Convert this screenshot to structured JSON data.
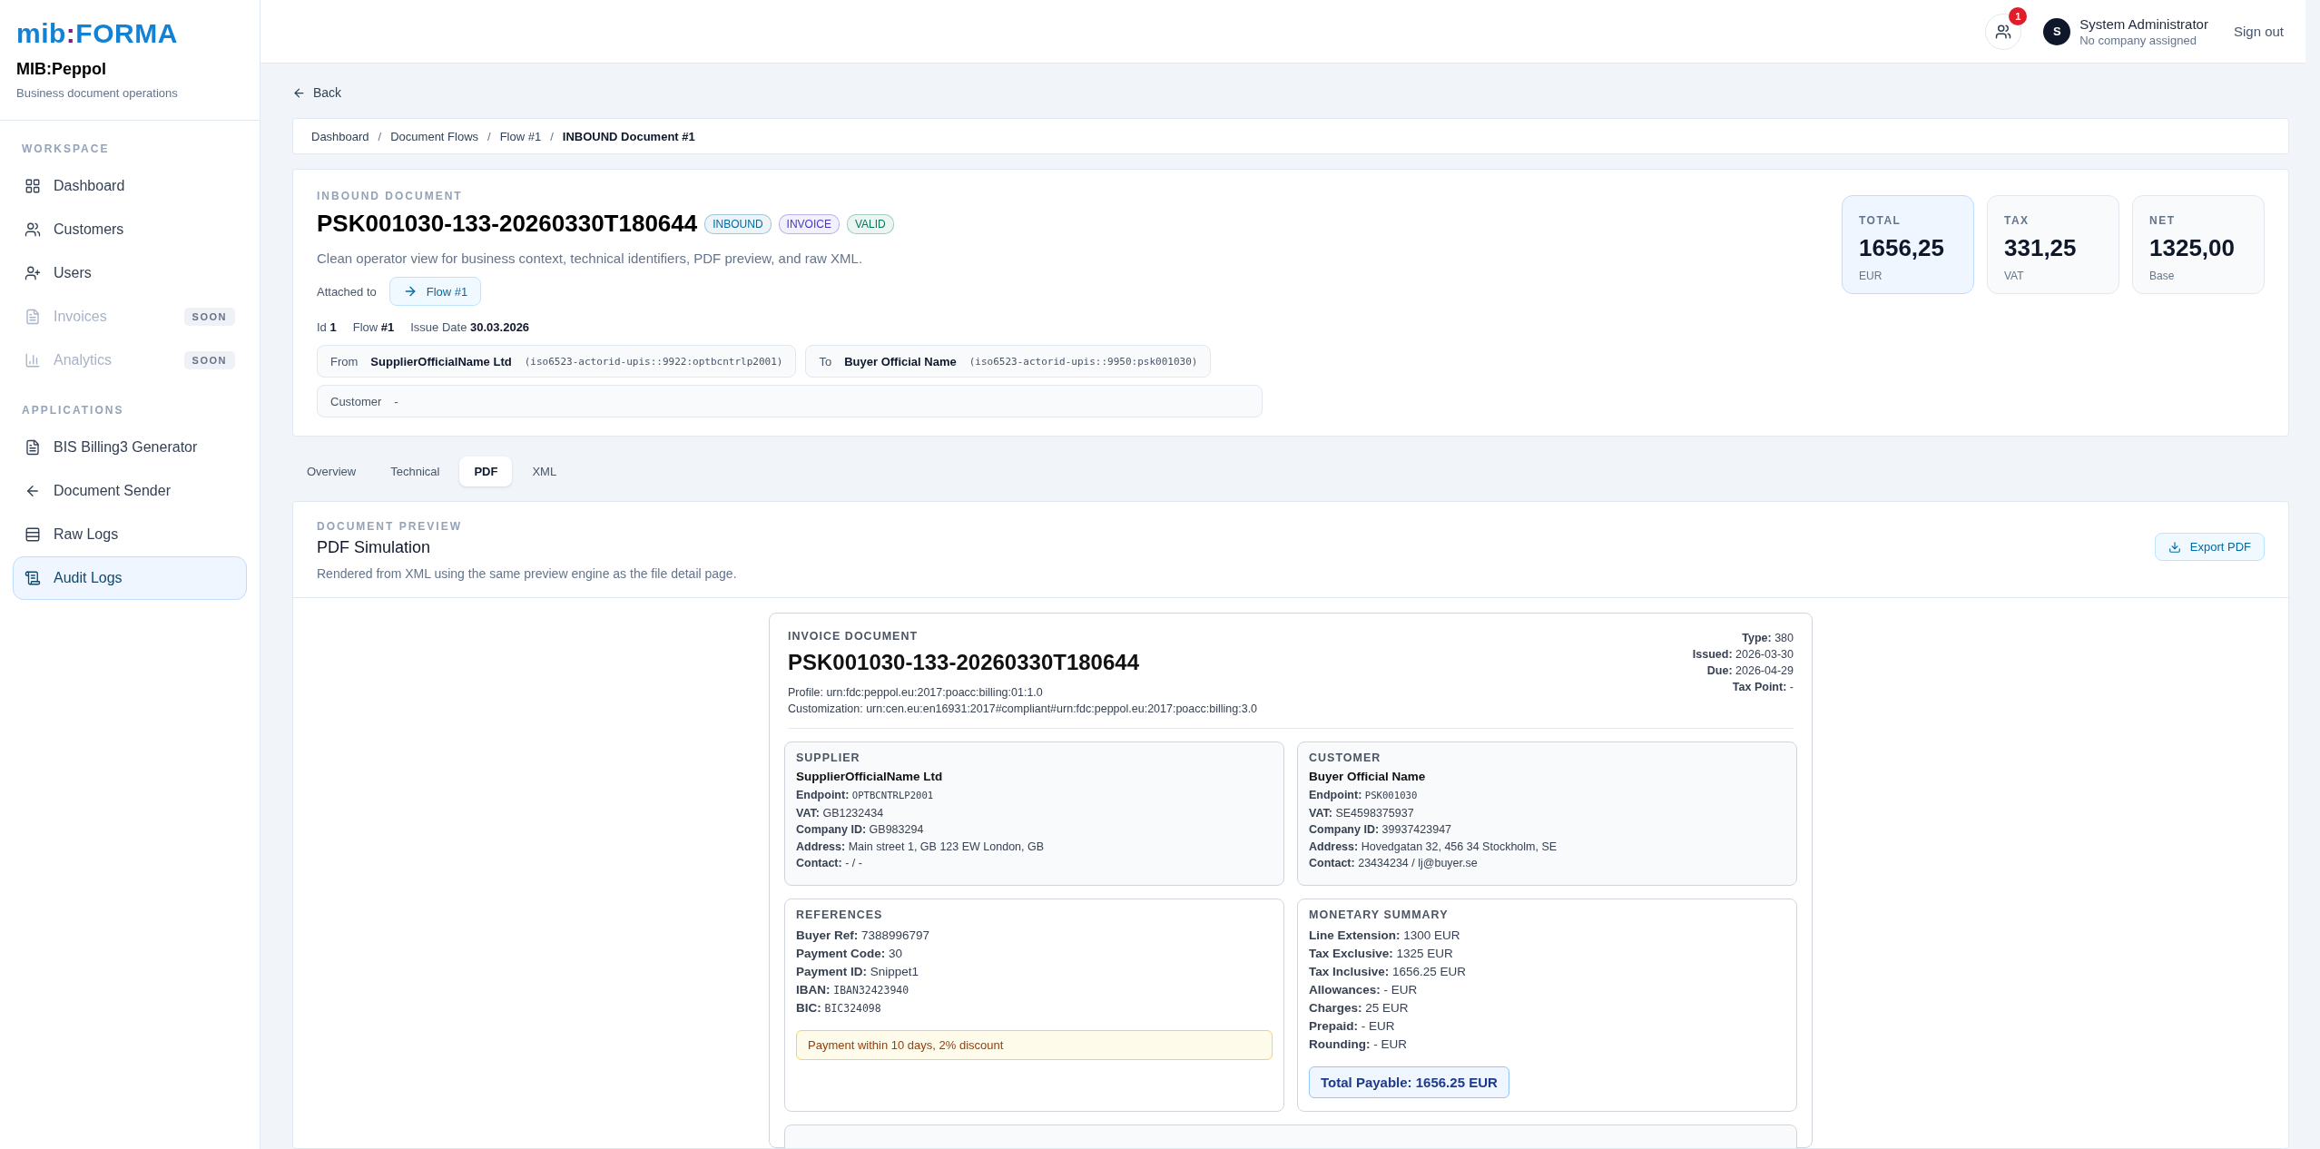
{
  "brand": {
    "logo_left": "mib",
    "logo_colon": ":",
    "logo_right": "FORMA",
    "app_name": "MIB:Peppol",
    "tagline": "Business document operations"
  },
  "sidebar": {
    "sections": [
      {
        "title": "WORKSPACE",
        "items": [
          {
            "label": "Dashboard",
            "selected": false,
            "disabled": false
          },
          {
            "label": "Customers",
            "selected": false,
            "disabled": false
          },
          {
            "label": "Users",
            "selected": false,
            "disabled": false
          },
          {
            "label": "Invoices",
            "selected": false,
            "disabled": true,
            "badge": "SOON"
          },
          {
            "label": "Analytics",
            "selected": false,
            "disabled": true,
            "badge": "SOON"
          }
        ]
      },
      {
        "title": "APPLICATIONS",
        "items": [
          {
            "label": "BIS Billing3 Generator",
            "selected": false,
            "disabled": false
          },
          {
            "label": "Document Sender",
            "selected": false,
            "disabled": false
          },
          {
            "label": "Raw Logs",
            "selected": false,
            "disabled": false
          },
          {
            "label": "Audit Logs",
            "selected": true,
            "disabled": false
          }
        ]
      }
    ]
  },
  "topbar": {
    "notifications": "1",
    "user": {
      "initial": "S",
      "name": "System Administrator",
      "company": "No company assigned"
    },
    "sign_out": "Sign out"
  },
  "back": "Back",
  "breadcrumb": [
    {
      "label": "Dashboard",
      "current": false
    },
    {
      "separator": "/",
      "label": "Document Flows",
      "current": false
    },
    {
      "separator": "/",
      "label": "Flow #1",
      "current": false
    },
    {
      "separator": "/",
      "label": "INBOUND Document #1",
      "current": true
    }
  ],
  "document": {
    "eyebrow": "INBOUND DOCUMENT",
    "title": "PSK001030-133-20260330T180644",
    "badges": [
      {
        "label": "INBOUND",
        "color": "#0369a1"
      },
      {
        "label": "INVOICE",
        "color": "#4338ca"
      },
      {
        "label": "VALID",
        "color": "#047857"
      }
    ],
    "description": "Clean operator view for business context, technical identifiers, PDF preview, and raw XML.",
    "attached_label": "Attached to",
    "attached_link": "Flow #1",
    "meta": [
      {
        "label": "Id",
        "value": "1"
      },
      {
        "label": "Flow",
        "value": "#1"
      },
      {
        "label": "Issue Date",
        "value": "30.03.2026"
      }
    ],
    "parties": [
      {
        "label": "From",
        "name": "SupplierOfficialName Ltd",
        "id": "(iso6523-actorid-upis::9922:optbcntrlp2001)"
      },
      {
        "label": "To",
        "name": "Buyer Official Name",
        "id": "(iso6523-actorid-upis::9950:psk001030)"
      }
    ],
    "customer": {
      "label": "Customer",
      "value": "-"
    }
  },
  "stats": [
    {
      "label": "TOTAL",
      "value": "1656,25",
      "unit": "EUR",
      "highlighted": true
    },
    {
      "label": "TAX",
      "value": "331,25",
      "unit": "VAT",
      "highlighted": false
    },
    {
      "label": "NET",
      "value": "1325,00",
      "unit": "Base",
      "highlighted": false
    }
  ],
  "tabs": [
    {
      "label": "Overview",
      "selected": false
    },
    {
      "label": "Technical",
      "selected": false
    },
    {
      "label": "PDF",
      "selected": true
    },
    {
      "label": "XML",
      "selected": false
    }
  ],
  "preview": {
    "eyebrow": "DOCUMENT PREVIEW",
    "title": "PDF Simulation",
    "description": "Rendered from XML using the same preview engine as the file detail page.",
    "export_button": "Export PDF"
  },
  "invoice": {
    "eyebrow": "INVOICE DOCUMENT",
    "title": "PSK001030-133-20260330T180644",
    "ids": [
      {
        "label": "Profile:",
        "value": "urn:fdc:peppol.eu:2017:poacc:billing:01:1.0"
      },
      {
        "label": "Customization:",
        "value": "urn:cen.eu:en16931:2017#compliant#urn:fdc:peppol.eu:2017:poacc:billing:3.0"
      }
    ],
    "facts": [
      {
        "label": "Type:",
        "value": "380"
      },
      {
        "label": "Issued:",
        "value": "2026-03-30"
      },
      {
        "label": "Due:",
        "value": "2026-04-29"
      },
      {
        "label": "Tax Point:",
        "value": "-"
      }
    ],
    "parties": [
      {
        "title": "SUPPLIER",
        "name": "SupplierOfficialName Ltd",
        "fields": [
          {
            "label": "Endpoint:",
            "value": "OPTBCNTRLP2001",
            "kind": "mono"
          },
          {
            "label": "VAT:",
            "value": "GB1232434"
          },
          {
            "label": "Company ID:",
            "value": "GB983294"
          },
          {
            "label": "Address:",
            "value": "Main street 1, GB 123 EW London, GB"
          },
          {
            "label": "Contact:",
            "value": "- / -"
          }
        ]
      },
      {
        "title": "CUSTOMER",
        "name": "Buyer Official Name",
        "fields": [
          {
            "label": "Endpoint:",
            "value": "PSK001030",
            "kind": "mono"
          },
          {
            "label": "VAT:",
            "value": "SE4598375937"
          },
          {
            "label": "Company ID:",
            "value": "39937423947"
          },
          {
            "label": "Address:",
            "value": "Hovedgatan 32, 456 34 Stockholm, SE"
          },
          {
            "label": "Contact:",
            "value": "23434234 / lj@buyer.se"
          }
        ]
      }
    ],
    "references": {
      "title": "REFERENCES",
      "fields": [
        {
          "label": "Buyer Ref:",
          "value": "7388996797"
        },
        {
          "label": "Payment Code:",
          "value": "30"
        },
        {
          "label": "Payment ID:",
          "value": "Snippet1"
        },
        {
          "label": "IBAN:",
          "value": "IBAN32423940",
          "kind": "mono"
        },
        {
          "label": "BIC:",
          "value": "BIC324098",
          "kind": "mono"
        }
      ],
      "note": "Payment within 10 days, 2% discount"
    },
    "monetary": {
      "title": "MONETARY SUMMARY",
      "fields": [
        {
          "label": "Line Extension:",
          "value": "1300 EUR"
        },
        {
          "label": "Tax Exclusive:",
          "value": "1325 EUR"
        },
        {
          "label": "Tax Inclusive:",
          "value": "1656.25 EUR"
        },
        {
          "label": "Allowances:",
          "value": "- EUR"
        },
        {
          "label": "Charges:",
          "value": "25 EUR"
        },
        {
          "label": "Prepaid:",
          "value": "- EUR"
        },
        {
          "label": "Rounding:",
          "value": "- EUR"
        }
      ],
      "total": "Total Payable: 1656.25 EUR"
    }
  }
}
